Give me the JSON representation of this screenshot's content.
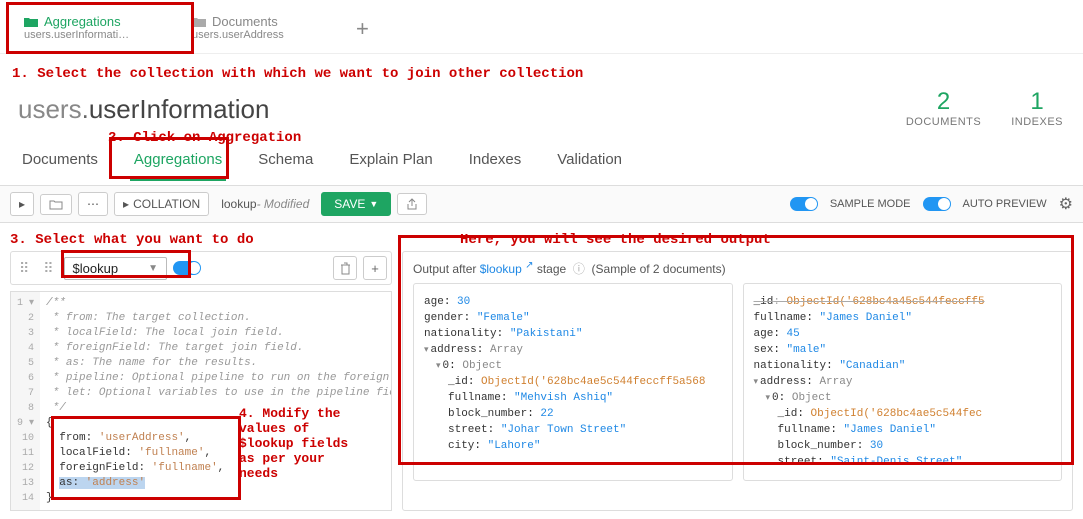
{
  "file_tabs": [
    {
      "type": "Aggregations",
      "sub": "users.userInformati…",
      "active": true,
      "color": "#1ea562"
    },
    {
      "type": "Documents",
      "sub": "users.userAddress",
      "active": false,
      "color": "#888"
    }
  ],
  "annot": {
    "step1": "1. Select the collection with which we want to join other collection",
    "step2": "2. Click on Aggregation",
    "step3": "3. Select what you want to do",
    "step4": "4. Modify the\nvalues of\n$lookup fields\nas per your\nneeds",
    "step5": "Here, you will see the desired output"
  },
  "crumb": {
    "db": "users",
    "coll": "userInformation"
  },
  "stats": [
    {
      "num": "2",
      "label": "DOCUMENTS"
    },
    {
      "num": "1",
      "label": "INDEXES"
    }
  ],
  "nav_tabs": [
    "Documents",
    "Aggregations",
    "Schema",
    "Explain Plan",
    "Indexes",
    "Validation"
  ],
  "active_nav": "Aggregations",
  "toolbar": {
    "collation": "COLLATION",
    "pipeline_name": "lookup",
    "pipeline_state": "- Modified",
    "save": "SAVE",
    "sample": "SAMPLE MODE",
    "auto": "AUTO PREVIEW"
  },
  "stage": {
    "operator": "$lookup"
  },
  "code": {
    "lines_comment": [
      "/**",
      " * from: The target collection.",
      " * localField: The local join field.",
      " * foreignField: The target join field.",
      " * as: The name for the results.",
      " * pipeline: Optional pipeline to run on the foreign co",
      " * let: Optional variables to use in the pipeline field",
      " */"
    ],
    "from": "'userAddress'",
    "localField": "'fullname'",
    "foreignField": "'fullname'",
    "as": "'address'"
  },
  "output": {
    "header_prefix": "Output after ",
    "header_link": "$lookup",
    "header_suffix": " stage",
    "sample": "(Sample of 2 documents)",
    "doc1": {
      "age": "30",
      "gender": "\"Female\"",
      "nationality": "\"Pakistani\"",
      "obj_id": "ObjectId('628bc4ae5c544feccff5a568",
      "fullname": "\"Mehvish Ashiq\"",
      "block_number": "22",
      "street": "\"Johar Town Street\"",
      "city": "\"Lahore\""
    },
    "doc2": {
      "id": "ObjectId('628bc4a45c544feccff5",
      "fullname": "\"James Daniel\"",
      "age": "45",
      "sex": "\"male\"",
      "nationality": "\"Canadian\"",
      "obj_id": "ObjectId('628bc4ae5c544fec",
      "inner_fullname": "\"James Daniel\"",
      "block_number": "30",
      "street": "\"Saint-Denis Street\""
    }
  }
}
